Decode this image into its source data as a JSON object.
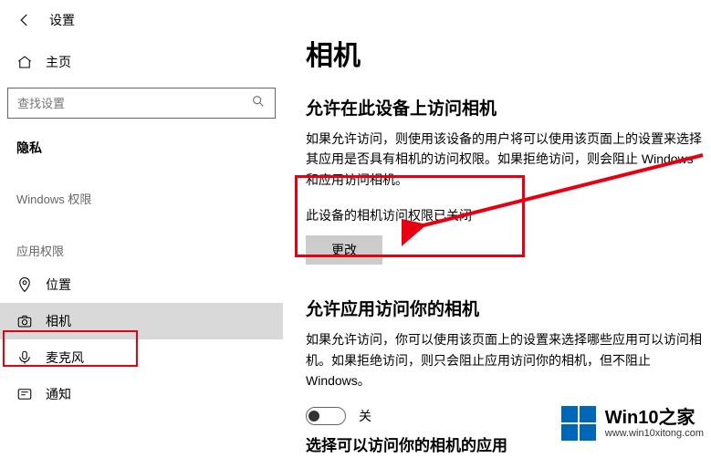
{
  "header": {
    "title": "设置"
  },
  "home": {
    "label": "主页"
  },
  "search": {
    "placeholder": "查找设置"
  },
  "sidebar": {
    "category": "隐私",
    "group1": "Windows 权限",
    "group2": "应用权限",
    "items": {
      "location": "位置",
      "camera": "相机",
      "mic": "麦克风",
      "notify": "通知"
    }
  },
  "page": {
    "title": "相机",
    "section1_title": "允许在此设备上访问相机",
    "section1_desc": "如果允许访问，则使用该设备的用户将可以使用该页面上的设置来选择其应用是否具有相机的访问权限。如果拒绝访问，则会阻止 Windows 和应用访问相机。",
    "status": "此设备的相机访问权限已关闭",
    "change_btn": "更改",
    "section2_title": "允许应用访问你的相机",
    "section2_desc": "如果允许访问，你可以使用该页面上的设置来选择哪些应用可以访问相机。如果拒绝访问，则只会阻止应用访问你的相机，但不阻止 Windows。",
    "toggle_label": "关",
    "cut_text": "选择可以访问你的相机的应用"
  },
  "watermark": {
    "brand": "Win10之家",
    "url": "www.win10xitong.com"
  }
}
